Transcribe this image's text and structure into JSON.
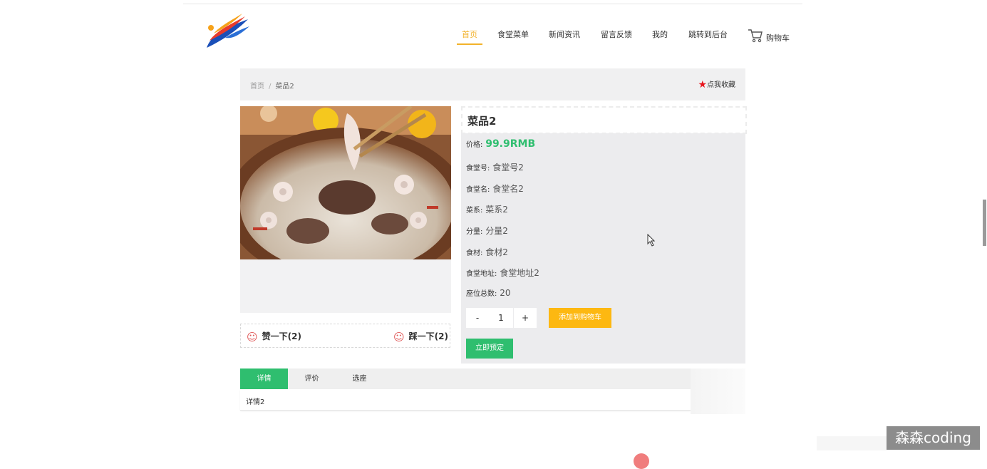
{
  "header": {
    "nav": [
      {
        "label": "首页",
        "active": true
      },
      {
        "label": "食堂菜单",
        "active": false
      },
      {
        "label": "新闻资讯",
        "active": false
      },
      {
        "label": "留言反馈",
        "active": false
      },
      {
        "label": "我的",
        "active": false
      },
      {
        "label": "跳转到后台",
        "active": false
      }
    ],
    "cart_label": "购物车",
    "accent_color": "#f2b22b"
  },
  "breadcrumb": {
    "home": "首页",
    "separator": "/",
    "current": "菜品2",
    "favorite_label": "点我收藏"
  },
  "votes": {
    "like_label": "赞一下(2)",
    "dislike_label": "踩一下(2)",
    "icon": "smile-icon"
  },
  "product": {
    "title": "菜品2",
    "price_label": "价格:",
    "price": "99.9RMB",
    "fields": [
      {
        "label": "食堂号:",
        "value": "食堂号2"
      },
      {
        "label": "食堂名:",
        "value": "食堂名2"
      },
      {
        "label": "菜系:",
        "value": "菜系2"
      },
      {
        "label": "分量:",
        "value": "分量2"
      },
      {
        "label": "食材:",
        "value": "食材2"
      },
      {
        "label": "食堂地址:",
        "value": "食堂地址2"
      },
      {
        "label": "座位总数:",
        "value": "20"
      }
    ],
    "quantity": {
      "minus": "-",
      "value": "1",
      "plus": "+"
    },
    "add_to_cart": "添加到购物车",
    "reserve": "立即预定",
    "price_color": "#2fbe6f"
  },
  "tabs": {
    "items": [
      "详情",
      "评价",
      "选座"
    ],
    "active_index": 0,
    "content": "详情2",
    "active_color": "#2fbe6f"
  },
  "watermark": "森森coding"
}
